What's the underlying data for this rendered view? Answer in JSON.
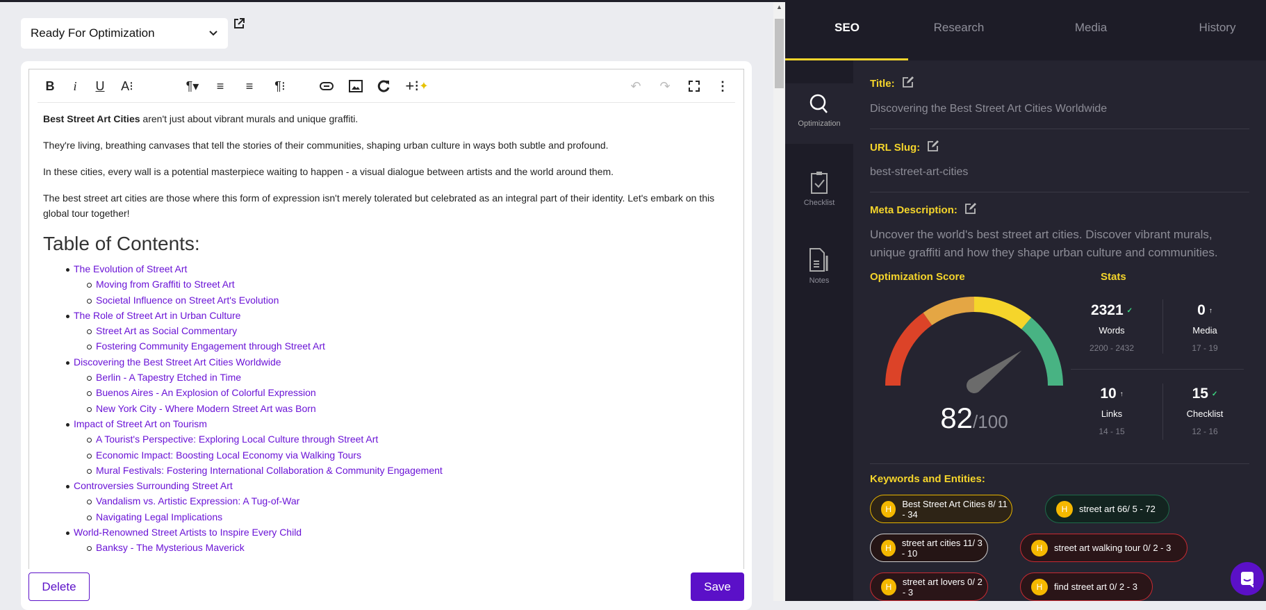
{
  "status_select": {
    "value": "Ready For Optimization"
  },
  "toolbar": {
    "bold": "B",
    "italic": "i",
    "underline": "U",
    "font_size": "A⁝",
    "paragraph": "¶▾",
    "align_left": "≡",
    "align_center": "≡",
    "paragraph_more": "¶⁝",
    "undo": "↶",
    "redo": "↷",
    "more": "⋮"
  },
  "editor": {
    "p1_bold": "Best Street Art Cities",
    "p1_rest": " aren't just about vibrant murals and unique graffiti.",
    "p2": "They're living, breathing canvases that tell the stories of their communities, shaping urban culture in ways both subtle and profound.",
    "p3": "In these cities, every wall is a potential masterpiece waiting to happen - a visual dialogue between artists and the world around them.",
    "p4": "The best street art cities are those where this form of expression isn't merely tolerated but celebrated as an integral part of their identity. Let's embark on this global tour together!",
    "toc_heading": "Table of Contents:",
    "toc": [
      {
        "level": 1,
        "text": "The Evolution of Street Art"
      },
      {
        "level": 2,
        "text": "Moving from Graffiti to Street Art"
      },
      {
        "level": 2,
        "text": "Societal Influence on Street Art's Evolution"
      },
      {
        "level": 1,
        "text": "The Role of Street Art in Urban Culture"
      },
      {
        "level": 2,
        "text": "Street Art as Social Commentary"
      },
      {
        "level": 2,
        "text": "Fostering Community Engagement through Street Art"
      },
      {
        "level": 1,
        "text": "Discovering the Best Street Art Cities Worldwide"
      },
      {
        "level": 2,
        "text": "Berlin - A Tapestry Etched in Time"
      },
      {
        "level": 2,
        "text": "Buenos Aires - An Explosion of Colorful Expression"
      },
      {
        "level": 2,
        "text": "New York City - Where Modern Street Art was Born"
      },
      {
        "level": 1,
        "text": "Impact of Street Art on Tourism"
      },
      {
        "level": 2,
        "text": "A Tourist's Perspective: Exploring Local Culture through Street Art"
      },
      {
        "level": 2,
        "text": "Economic Impact: Boosting Local Economy via Walking Tours"
      },
      {
        "level": 2,
        "text": "Mural Festivals: Fostering International Collaboration & Community Engagement"
      },
      {
        "level": 1,
        "text": "Controversies Surrounding Street Art"
      },
      {
        "level": 2,
        "text": "Vandalism vs. Artistic Expression: A Tug-of-War"
      },
      {
        "level": 2,
        "text": "Navigating Legal Implications"
      },
      {
        "level": 1,
        "text": "World-Renowned Street Artists to Inspire Every Child"
      },
      {
        "level": 2,
        "text": "Banksy - The Mysterious Maverick"
      }
    ]
  },
  "actions": {
    "delete": "Delete",
    "save": "Save"
  },
  "tabs": [
    {
      "label": "SEO",
      "active": true
    },
    {
      "label": "Research"
    },
    {
      "label": "Media"
    },
    {
      "label": "History"
    }
  ],
  "side": [
    {
      "label": "Optimization",
      "icon": "search-icon",
      "active": true
    },
    {
      "label": "Checklist",
      "icon": "clipboard-check-icon"
    },
    {
      "label": "Notes",
      "icon": "note-pen-icon"
    }
  ],
  "seo": {
    "title_label": "Title:",
    "title_value": "Discovering the Best Street Art Cities Worldwide",
    "slug_label": "URL Slug:",
    "slug_value": "best-street-art-cities",
    "meta_label": "Meta Description:",
    "meta_line1": "Uncover the world's best street art cities. Discover vibrant murals,",
    "meta_line2": "unique graffiti and how they shape urban culture and communities.",
    "score_label": "Optimization Score",
    "score": "82",
    "score_max": "/100",
    "score_value": 82,
    "stats_label": "Stats",
    "stats": [
      {
        "value": "2321",
        "mark": "✓",
        "mark_color": "#3ddc84",
        "label": "Words",
        "range": "2200 - 2432"
      },
      {
        "value": "0",
        "mark": "↑",
        "mark_color": "#ffffff",
        "label": "Media",
        "range": "17 - 19"
      },
      {
        "value": "10",
        "mark": "↑",
        "mark_color": "#ffffff",
        "label": "Links",
        "range": "14 - 15"
      },
      {
        "value": "15",
        "mark": "✓",
        "mark_color": "#3ddc84",
        "label": "Checklist",
        "range": "12 - 16"
      }
    ],
    "keywords_label": "Keywords and Entities:",
    "keywords": [
      {
        "badge": "H",
        "text": "Best Street Art Cities 8/ 11 - 34",
        "border": "#e6b400",
        "bg": "#2e2416"
      },
      {
        "badge": "H",
        "text": "street art 66/ 5 - 72",
        "border": "#1e6b4a",
        "bg": "#132420"
      },
      {
        "badge": "H",
        "text": "street art cities 11/ 3 - 10",
        "border": "#cfcfcf",
        "bg": "#251515"
      },
      {
        "badge": "H",
        "text": "street art walking tour 0/ 2 - 3",
        "border": "#c92a32",
        "bg": "#2a1518"
      },
      {
        "badge": "H",
        "text": "street art lovers 0/ 2 - 3",
        "border": "#c92a32",
        "bg": "#2a1518"
      },
      {
        "badge": "H",
        "text": "find street art 0/ 2 - 3",
        "border": "#c92a32",
        "bg": "#2a1518"
      }
    ]
  },
  "colors": {
    "accent": "#f5d52b",
    "primary": "#5b10c8",
    "gauge": [
      "#dc4328",
      "#e4a644",
      "#f5d52b",
      "#48b383"
    ]
  }
}
